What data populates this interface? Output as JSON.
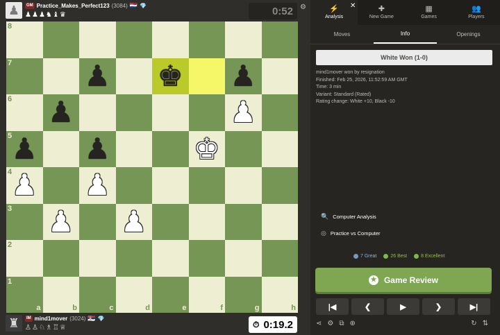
{
  "top_player": {
    "title": "GM",
    "name": "Practice_Makes_Perfect123",
    "rating": "(3084)",
    "flag": "🇳🇱",
    "diamond": "💎",
    "captured": [
      "♟",
      "♟",
      "♟",
      "♞",
      "♝",
      "♛"
    ],
    "clock": "0:52",
    "avatar_icon": "♟"
  },
  "bottom_player": {
    "title": "IM",
    "name": "mind1mover",
    "rating": "(3024)",
    "flag": "🇷🇸",
    "diamond": "💎",
    "captured": [
      "♙",
      "♙",
      "♘",
      "♗",
      "♖",
      "♕"
    ],
    "clock": "0:19.2",
    "clock_icon": "⏱",
    "avatar_icon": "♜"
  },
  "board": {
    "files": [
      "a",
      "b",
      "c",
      "d",
      "e",
      "f",
      "g",
      "h"
    ],
    "ranks": [
      "8",
      "7",
      "6",
      "5",
      "4",
      "3",
      "2",
      "1"
    ],
    "highlight": [
      "e7",
      "f7"
    ],
    "pieces": [
      {
        "sq": "e7",
        "color": "b",
        "glyph": "♚",
        "name": "black-king-e7"
      },
      {
        "sq": "c7",
        "color": "b",
        "glyph": "♟",
        "name": "black-pawn-c7"
      },
      {
        "sq": "g7",
        "color": "b",
        "glyph": "♟",
        "name": "black-pawn-g7"
      },
      {
        "sq": "b6",
        "color": "b",
        "glyph": "♟",
        "name": "black-pawn-b6"
      },
      {
        "sq": "g6",
        "color": "w",
        "glyph": "♟",
        "name": "white-pawn-g6"
      },
      {
        "sq": "a5",
        "color": "b",
        "glyph": "♟",
        "name": "black-pawn-a5"
      },
      {
        "sq": "c5",
        "color": "b",
        "glyph": "♟",
        "name": "black-pawn-c5"
      },
      {
        "sq": "f5",
        "color": "w",
        "glyph": "♚",
        "name": "white-king-f5"
      },
      {
        "sq": "a4",
        "color": "w",
        "glyph": "♟",
        "name": "white-pawn-a4"
      },
      {
        "sq": "c4",
        "color": "w",
        "glyph": "♟",
        "name": "white-pawn-c4"
      },
      {
        "sq": "b3",
        "color": "w",
        "glyph": "♟",
        "name": "white-pawn-b3"
      },
      {
        "sq": "d3",
        "color": "w",
        "glyph": "♟",
        "name": "white-pawn-d3"
      }
    ],
    "colors": {
      "light": "#eeeed2",
      "dark": "#769656",
      "highlight_light": "#f6f669",
      "highlight_dark": "#baca2b"
    }
  },
  "tabs": [
    {
      "label": "Analysis",
      "icon": "⚡"
    },
    {
      "label": "New Game",
      "icon": "✚"
    },
    {
      "label": "Games",
      "icon": "▦"
    },
    {
      "label": "Players",
      "icon": "👥"
    }
  ],
  "close_icon": "✕",
  "gear_icon": "⚙",
  "subtabs": [
    "Moves",
    "Info",
    "Openings"
  ],
  "result": "White Won (1-0)",
  "details": [
    "mind1mover won by resignation",
    "Finished: Feb 25, 2026, 11:52:59 AM GMT",
    "Time: 3 min",
    "Variant: Standard (Rated)",
    "Rating change: White +10, Black -10"
  ],
  "actions": [
    {
      "label": "Computer Analysis",
      "icon": "🔍"
    },
    {
      "label": "Practice vs Computer",
      "icon": "◎"
    }
  ],
  "stats": [
    {
      "label": "7 Great",
      "color": "#749bbf",
      "text_color": "#8bb4dc"
    },
    {
      "label": "26 Best",
      "color": "#81b64c",
      "text_color": "#96bc4b"
    },
    {
      "label": "8 Excellent",
      "color": "#81b64c",
      "text_color": "#96bc4b"
    }
  ],
  "review_button": {
    "label": "Game Review",
    "icon": "★",
    "color": "#7fa650"
  },
  "nav_buttons": [
    {
      "label": "|◀",
      "name": "first-move-button"
    },
    {
      "label": "❮",
      "name": "previous-move-button"
    },
    {
      "label": "▶",
      "name": "play-button"
    },
    {
      "label": "❯",
      "name": "next-move-button"
    },
    {
      "label": "▶|",
      "name": "last-move-button"
    }
  ],
  "tools_left": [
    {
      "icon": "⋖",
      "name": "share-icon"
    },
    {
      "icon": "⚙",
      "name": "analysis-settings-icon"
    },
    {
      "icon": "⧉",
      "name": "copy-icon"
    },
    {
      "icon": "⊕",
      "name": "zoom-icon"
    }
  ],
  "tools_right": [
    {
      "icon": "↻",
      "name": "rematch-icon"
    },
    {
      "icon": "⇅",
      "name": "flip-board-icon"
    }
  ]
}
